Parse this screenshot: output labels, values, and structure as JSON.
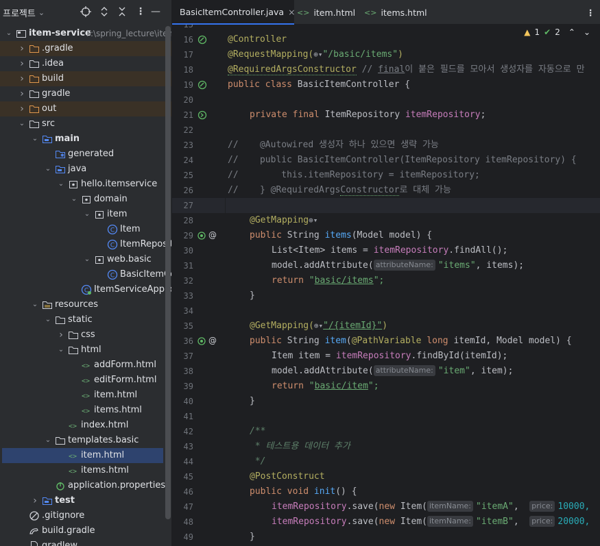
{
  "sidebar": {
    "title": "프로젝트",
    "title_dropdown": "⌄",
    "toolbar": {
      "locate": "⊕",
      "expand": "⌃",
      "collapse": "✕",
      "options": "⋮",
      "hide": "—"
    },
    "tree": [
      {
        "label": "item-service",
        "sub": "F:\\spring_lecture\\item",
        "bold": true
      },
      {
        "label": ".gradle"
      },
      {
        "label": ".idea"
      },
      {
        "label": "build"
      },
      {
        "label": "gradle"
      },
      {
        "label": "out"
      },
      {
        "label": "src"
      },
      {
        "label": "main",
        "bold": true
      },
      {
        "label": "generated"
      },
      {
        "label": "java"
      },
      {
        "label": "hello.itemservice"
      },
      {
        "label": "domain"
      },
      {
        "label": "item"
      },
      {
        "label": "Item"
      },
      {
        "label": "ItemRepository"
      },
      {
        "label": "web.basic"
      },
      {
        "label": "BasicItemController"
      },
      {
        "label": "ItemServiceApplication"
      },
      {
        "label": "resources"
      },
      {
        "label": "static"
      },
      {
        "label": "css"
      },
      {
        "label": "html"
      },
      {
        "label": "addForm.html"
      },
      {
        "label": "editForm.html"
      },
      {
        "label": "item.html"
      },
      {
        "label": "items.html"
      },
      {
        "label": "index.html"
      },
      {
        "label": "templates.basic"
      },
      {
        "label": "item.html"
      },
      {
        "label": "items.html"
      },
      {
        "label": "application.properties"
      },
      {
        "label": "test",
        "bold": true
      },
      {
        "label": ".gitignore"
      },
      {
        "label": "build.gradle"
      },
      {
        "label": "gradlew"
      }
    ]
  },
  "tabs": [
    {
      "label": "BasicItemController.java",
      "close": "×"
    },
    {
      "label": "item.html"
    },
    {
      "label": "items.html"
    }
  ],
  "tab_menu": "⋮",
  "indicators": {
    "warnings": "1",
    "ok": "2",
    "up": "⌃",
    "down": "⌄"
  },
  "editor": {
    "line_numbers": [
      "15",
      "16",
      "17",
      "18",
      "19",
      "20",
      "21",
      "22",
      "23",
      "24",
      "25",
      "26",
      "27",
      "28",
      "29",
      "30",
      "31",
      "32",
      "33",
      "34",
      "35",
      "36",
      "37",
      "38",
      "39",
      "40",
      "41",
      "42",
      "43",
      "44",
      "45",
      "46",
      "47",
      "48",
      "49"
    ],
    "lines": {
      "l15": "",
      "l16": "@Controller",
      "l17a": "@RequestMapping(",
      "l17b": "\"/basic/items\"",
      "l17c": ")",
      "l18a": "@RequiredArgsConstructor",
      "l18b": " // ",
      "l18c": "final",
      "l18d": "이 붙은 필드를 모아서 생성자를 자동으로 만",
      "l19a": "public class ",
      "l19b": "BasicItemController {",
      "l21a": "private final ",
      "l21b": "ItemRepository ",
      "l21c": "itemRepository",
      "l21d": ";",
      "l23": "//    @Autowired 생성자 하나 있으면 생략 가능",
      "l24": "//    public BasicItemController(ItemRepository itemRepository) {",
      "l25": "//        this.itemRepository = itemRepository;",
      "l26a": "//    } @RequiredArgs",
      "l26b": "Constructor",
      "l26c": "로 대체 가능",
      "l28a": "@GetMapping",
      "l29a": "public ",
      "l29b": "String ",
      "l29c": "items",
      "l29d": "(Model model) {",
      "l30a": "List<Item> items = ",
      "l30b": "itemRepository",
      "l30c": ".findAll();",
      "l31a": "model.addAttribute(",
      "l31hint": "attributeName:",
      "l31b": "\"items\"",
      "l31c": ", items);",
      "l32a": "return ",
      "l32b": "\"",
      "l32c": "basic/items",
      "l32d": "\";",
      "l33": "}",
      "l35a": "@GetMapping(",
      "l35b": "\"/{itemId}\"",
      "l35c": ")",
      "l36a": "public ",
      "l36b": "String ",
      "l36c": "item",
      "l36d": "(",
      "l36e": "@PathVariable ",
      "l36f": "long ",
      "l36g": "itemId, Model model) {",
      "l37a": "Item item = ",
      "l37b": "itemRepository",
      "l37c": ".findById(itemId);",
      "l38a": "model.addAttribute(",
      "l38hint": "attributeName:",
      "l38b": "\"item\"",
      "l38c": ", item);",
      "l39a": "return ",
      "l39b": "\"",
      "l39c": "basic/item",
      "l39d": "\";",
      "l40": "}",
      "l42": "/**",
      "l43": " * 테스트용 데이터 추가",
      "l44": " */",
      "l45": "@PostConstruct",
      "l46a": "public void ",
      "l46b": "init",
      "l46c": "() {",
      "l47a": "itemRepository",
      "l47b": ".save(",
      "l47c": "new ",
      "l47d": "Item(",
      "l47hint1": "itemName:",
      "l47e": "\"itemA\"",
      "l47f": ",  ",
      "l47hint2": "price:",
      "l47g": "10000,",
      "l48a": "itemRepository",
      "l48b": ".save(",
      "l48c": "new ",
      "l48d": "Item(",
      "l48hint1": "itemName:",
      "l48e": "\"itemB\"",
      "l48f": ",  ",
      "l48hint2": "price:",
      "l48g": "20000,",
      "l49": "}"
    }
  }
}
